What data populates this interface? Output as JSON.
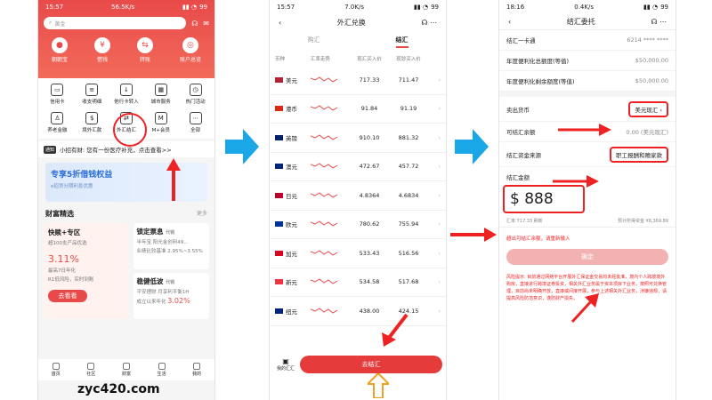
{
  "phone1": {
    "status_time": "15:57",
    "status_speed": "56.5K/s",
    "battery": "99",
    "search_placeholder": "黄金",
    "top": [
      "朝朝宝",
      "借钱",
      "转账",
      "账户总览"
    ],
    "grid": [
      {
        "label": "信用卡",
        "icon": "card-icon"
      },
      {
        "label": "收支明细",
        "icon": "receipt-icon"
      },
      {
        "label": "他行卡转入",
        "icon": "transfer-in-icon"
      },
      {
        "label": "城市服务",
        "icon": "city-icon"
      },
      {
        "label": "热门活动",
        "icon": "clock-icon"
      },
      {
        "label": "养老金融",
        "icon": "pension-icon"
      },
      {
        "label": "境外汇款",
        "icon": "remit-icon"
      },
      {
        "label": "外汇结汇",
        "icon": "fx-icon"
      },
      {
        "label": "M+会员",
        "icon": "member-icon"
      },
      {
        "label": "全部",
        "icon": "more-icon"
      }
    ],
    "notice_tag": "通知",
    "notice_text": "小招有财: 您有一份医疗补充，点击查看>>",
    "banner_title": "专享5折借钱权益",
    "banner_sub": "e招贷分期利息优惠",
    "section_title": "财富精选",
    "section_more": "更多",
    "cardL": {
      "title": "快赎+专区",
      "sub": "超100支产品优选",
      "rate": "3.11%",
      "rate_note": "最高7日年化",
      "risk": "R1低风险，实时到账",
      "btn": "去看看"
    },
    "cardR1": {
      "title": "锁定票息",
      "tag": "代销",
      "sub": "半年宝  阳光金创利49...",
      "note": "业绩比较基准 2.95%~3.55%"
    },
    "cardR2": {
      "title": "稳健低波",
      "tag": "代销",
      "sub": "平安理财 月享利平衡1H",
      "note": "成立以来年化",
      "rate": "3.02%"
    },
    "tabs": [
      "首页",
      "社区",
      "财富",
      "生活",
      "我的"
    ],
    "watermark": "zyc420.com"
  },
  "phone2": {
    "status_time": "15:57",
    "status_speed": "7.0K/s",
    "battery": "99",
    "title": "外汇兑换",
    "tab_buy": "购汇",
    "tab_sell": "结汇",
    "cols": [
      "币种",
      "汇率走势",
      "现汇买入价",
      "现钞买入价"
    ],
    "rows": [
      {
        "cur": "美元",
        "flag": "#b22234",
        "a": "717.33",
        "b": "711.47"
      },
      {
        "cur": "港币",
        "flag": "#de2910",
        "a": "91.84",
        "b": "91.19"
      },
      {
        "cur": "英镑",
        "flag": "#012169",
        "a": "910.10",
        "b": "881.32"
      },
      {
        "cur": "澳元",
        "flag": "#00247d",
        "a": "472.67",
        "b": "457.72"
      },
      {
        "cur": "日元",
        "flag": "#bc002d",
        "a": "4.8364",
        "b": "4.6834"
      },
      {
        "cur": "欧元",
        "flag": "#003399",
        "a": "780.62",
        "b": "755.94"
      },
      {
        "cur": "加元",
        "flag": "#d80621",
        "a": "533.43",
        "b": "516.56"
      },
      {
        "cur": "新元",
        "flag": "#ef3340",
        "a": "534.58",
        "b": "517.68"
      },
      {
        "cur": "纽元",
        "flag": "#00247d",
        "a": "438.00",
        "b": "424.15"
      }
    ],
    "btn": "去结汇",
    "corner": "我的汇汇"
  },
  "phone3": {
    "status_time": "18:16",
    "status_speed": "0.4K/s",
    "battery": "99",
    "title": "结汇委托",
    "card_label": "结汇一卡通",
    "card_value": "6214 **** ****",
    "quota1_label": "年度便利化总额度(等值)",
    "quota1_value": "$50,000.00",
    "quota2_label": "年度便利化剩余额度(等值)",
    "quota2_value": "$50,000.00",
    "sell_label": "卖出货币",
    "sell_value": "美元现汇",
    "bal_label": "可结汇余额",
    "bal_value": "0.00 (美元现汇)",
    "src_label": "结汇资金来源",
    "src_value": "职工报酬和赡家款",
    "amt_label": "结汇金额",
    "amt_symbol": "$",
    "amt_value": "888",
    "rate_text": "汇率 717.33 刷新",
    "est_text": "预计所得资金 ¥6,369.89",
    "err": "超出可结汇余额，请重新输入",
    "confirm": "确定",
    "risk": "风险提示: 目前通过网络平台开展外汇保证金交易均未经批准，境内个人跨境境外购房，直接进行跨境证券投资，相关外汇业务属于资本项目下业务，按照可兑换管理，目前尚未明确开放，直接或间接开展，参与上述相关外汇业务，涉嫌违规，请提高风险防范意识，谨防财产损失。"
  },
  "colors": {
    "accent": "#e84a4a",
    "arrow": "#e22222",
    "flow_arrow": "#1aa7e8"
  }
}
